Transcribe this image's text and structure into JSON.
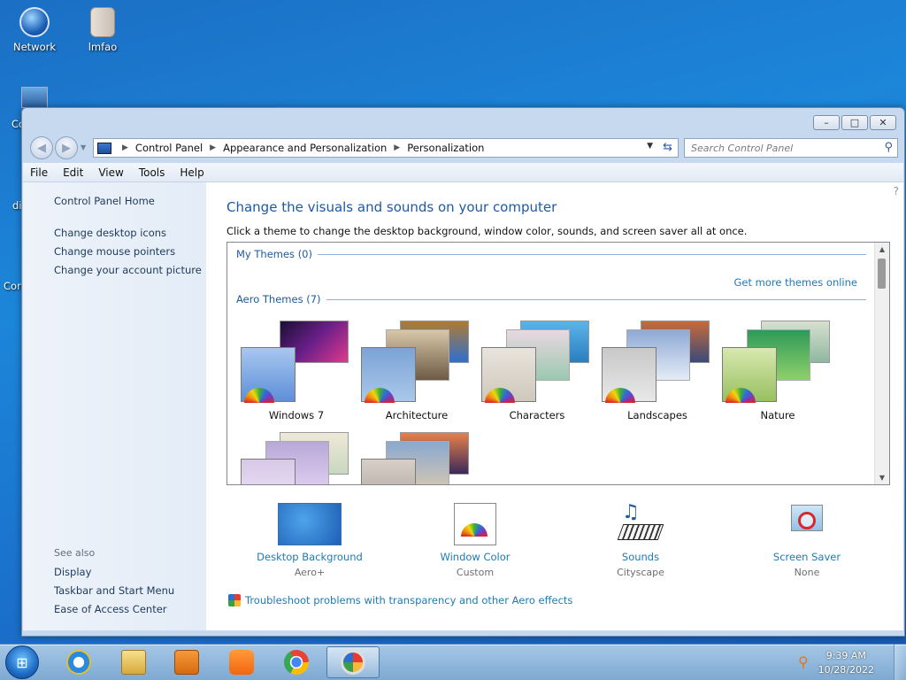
{
  "desktop": {
    "icons": [
      {
        "label": "Network",
        "icon": "network-icon"
      },
      {
        "label": "lmfao",
        "icon": "folder-icon"
      }
    ],
    "partial_labels": [
      "Co",
      "di",
      "Con"
    ]
  },
  "window": {
    "buttons": {
      "minimize": "–",
      "maximize": "□",
      "close": "✕"
    },
    "address": {
      "crumbs": [
        "Control Panel",
        "Appearance and Personalization",
        "Personalization"
      ]
    },
    "search_placeholder": "Search Control Panel",
    "menu": [
      "File",
      "Edit",
      "View",
      "Tools",
      "Help"
    ]
  },
  "sidebar": {
    "home": "Control Panel Home",
    "links": [
      "Change desktop icons",
      "Change mouse pointers",
      "Change your account picture"
    ],
    "see_also_label": "See also",
    "see_also": [
      "Display",
      "Taskbar and Start Menu",
      "Ease of Access Center"
    ]
  },
  "main": {
    "heading": "Change the visuals and sounds on your computer",
    "subtext": "Click a theme to change the desktop background, window color, sounds, and screen saver all at once.",
    "my_themes": "My Themes (0)",
    "get_more": "Get more themes online",
    "aero_themes": "Aero Themes (7)",
    "themes": [
      "Windows 7",
      "Architecture",
      "Characters",
      "Landscapes",
      "Nature"
    ],
    "bottom": [
      {
        "label": "Desktop Background",
        "value": "Aero+"
      },
      {
        "label": "Window Color",
        "value": "Custom"
      },
      {
        "label": "Sounds",
        "value": "Cityscape"
      },
      {
        "label": "Screen Saver",
        "value": "None"
      }
    ],
    "troubleshoot": "Troubleshoot problems with transparency and other Aero effects"
  },
  "taskbar": {
    "apps": [
      "internet-explorer-icon",
      "file-explorer-icon",
      "media-player-icon",
      "uc-browser-icon",
      "chrome-icon",
      "personalization-icon"
    ],
    "time": "9:39 AM",
    "date": "10/28/2022"
  }
}
